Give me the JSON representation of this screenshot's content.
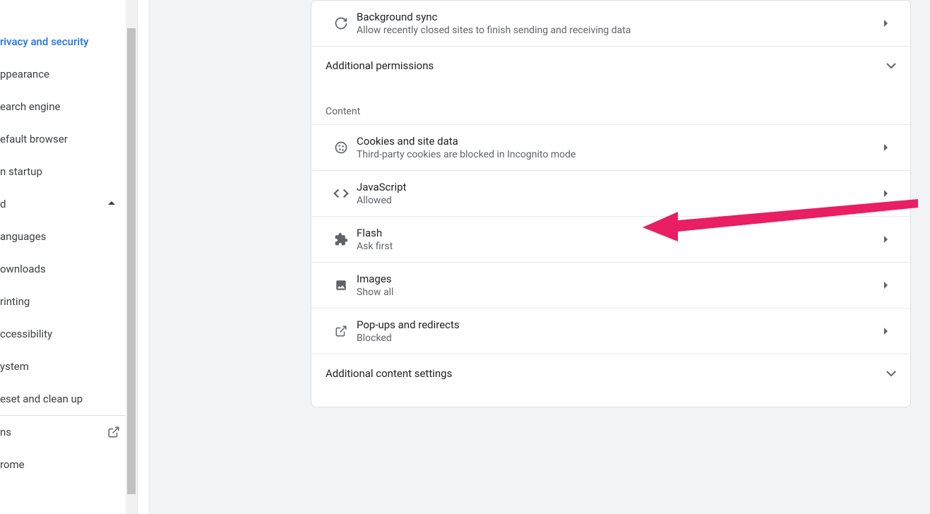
{
  "sidebar": {
    "items": [
      {
        "label": "rivacy and security",
        "active": true
      },
      {
        "label": "ppearance"
      },
      {
        "label": "earch engine"
      },
      {
        "label": "efault browser"
      },
      {
        "label": "n startup"
      }
    ],
    "advanced_label": "d",
    "advanced_items": [
      {
        "label": "anguages"
      },
      {
        "label": "ownloads"
      },
      {
        "label": "rinting"
      },
      {
        "label": "ccessibility"
      },
      {
        "label": "ystem"
      },
      {
        "label": "eset and clean up"
      }
    ],
    "extensions_label": "ns",
    "about_label": "rome"
  },
  "content": {
    "bg_sync": {
      "label": "Background sync",
      "sub": "Allow recently closed sites to finish sending and receiving data"
    },
    "additional_permissions": "Additional permissions",
    "section_heading": "Content",
    "cookies": {
      "label": "Cookies and site data",
      "sub": "Third-party cookies are blocked in Incognito mode"
    },
    "javascript": {
      "label": "JavaScript",
      "sub": "Allowed"
    },
    "flash": {
      "label": "Flash",
      "sub": "Ask first"
    },
    "images": {
      "label": "Images",
      "sub": "Show all"
    },
    "popups": {
      "label": "Pop-ups and redirects",
      "sub": "Blocked"
    },
    "additional_content": "Additional content settings"
  }
}
